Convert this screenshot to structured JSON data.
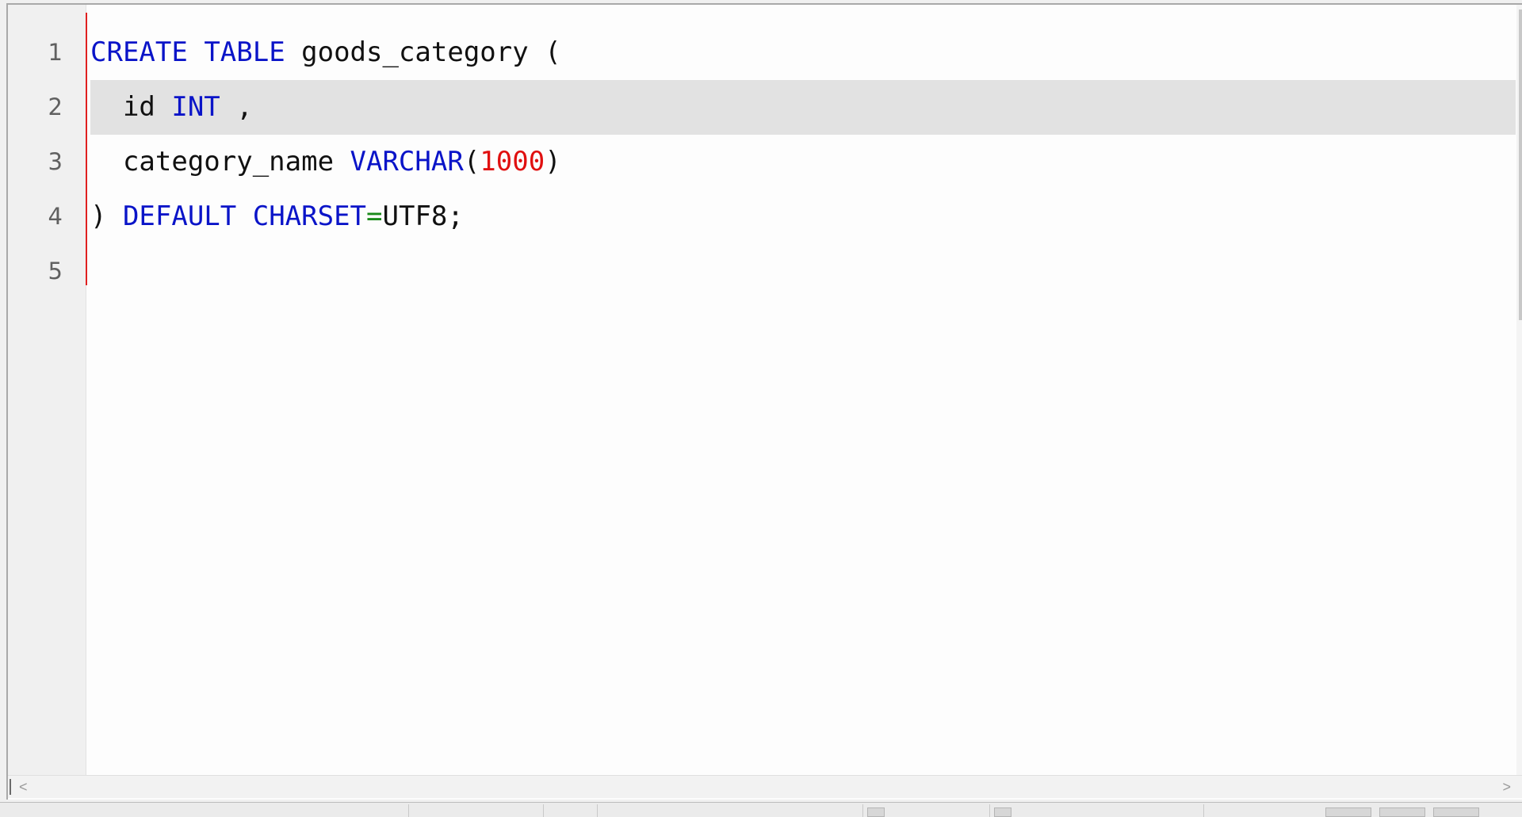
{
  "editor": {
    "line_numbers": [
      "1",
      "2",
      "3",
      "4",
      "5"
    ],
    "current_line": 2,
    "lines": [
      {
        "tokens": [
          {
            "t": "CREATE",
            "c": "kw"
          },
          {
            "t": " ",
            "c": "plain"
          },
          {
            "t": "TABLE",
            "c": "kw"
          },
          {
            "t": " goods_category (",
            "c": "plain"
          }
        ]
      },
      {
        "tokens": [
          {
            "t": "  id ",
            "c": "plain"
          },
          {
            "t": "INT",
            "c": "kw"
          },
          {
            "t": " ,",
            "c": "plain"
          }
        ]
      },
      {
        "tokens": [
          {
            "t": "  category_name ",
            "c": "plain"
          },
          {
            "t": "VARCHAR",
            "c": "kw"
          },
          {
            "t": "(",
            "c": "plain"
          },
          {
            "t": "1000",
            "c": "num"
          },
          {
            "t": ")",
            "c": "plain"
          }
        ]
      },
      {
        "tokens": [
          {
            "t": ") ",
            "c": "plain"
          },
          {
            "t": "DEFAULT",
            "c": "kw"
          },
          {
            "t": " ",
            "c": "plain"
          },
          {
            "t": "CHARSET",
            "c": "kw"
          },
          {
            "t": "=",
            "c": "op"
          },
          {
            "t": "UTF8;",
            "c": "plain"
          }
        ]
      },
      {
        "tokens": []
      }
    ]
  },
  "scrollbar": {
    "left_arrow": "<",
    "right_arrow": ">"
  },
  "colors": {
    "keyword": "#0a14c8",
    "number": "#e01010",
    "operator": "#1a8a1a",
    "text": "#111111",
    "current_line_bg": "#e2e2e2",
    "modified_marker": "#e02020"
  }
}
